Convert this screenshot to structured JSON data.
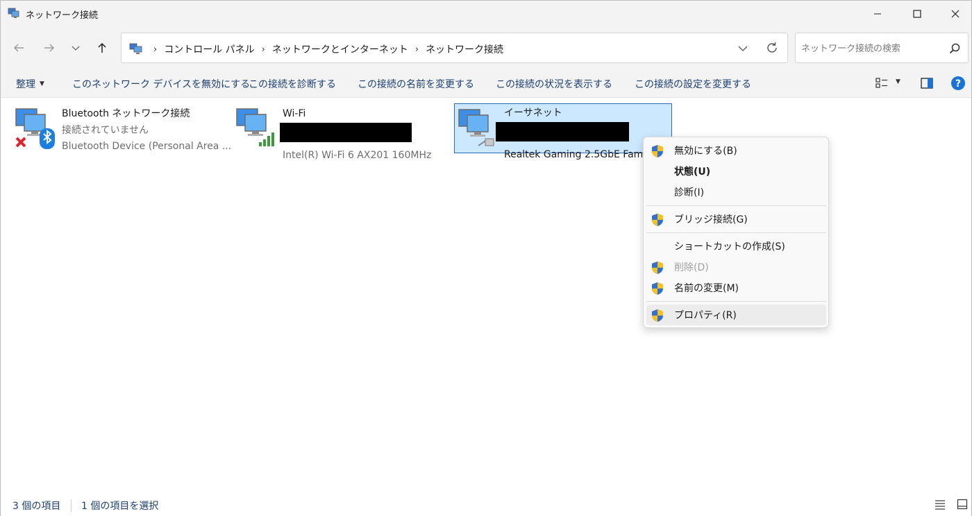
{
  "window": {
    "title": "ネットワーク接続"
  },
  "address": {
    "crumbs": [
      "コントロール パネル",
      "ネットワークとインターネット",
      "ネットワーク接続"
    ]
  },
  "search": {
    "placeholder": "ネットワーク接続の検索"
  },
  "commands": {
    "organize": "整理",
    "disable": "このネットワーク デバイスを無効にする",
    "diagnose": "この接続を診断する",
    "rename": "この接続の名前を変更する",
    "status": "この接続の状況を表示する",
    "settings": "この接続の設定を変更する"
  },
  "connections": [
    {
      "name": "Bluetooth ネットワーク接続",
      "status": "接続されていません",
      "device": "Bluetooth Device (Personal Area ...",
      "icon": "bluetooth-network-icon"
    },
    {
      "name": "Wi-Fi",
      "status": "",
      "device": "Intel(R) Wi-Fi 6 AX201 160MHz",
      "icon": "wifi-network-icon"
    },
    {
      "name": "イーサネット",
      "status": "",
      "device": "Realtek Gaming 2.5GbE Family",
      "icon": "ethernet-network-icon"
    }
  ],
  "context_menu": {
    "items": [
      {
        "label": "無効にする(B)",
        "shield": true
      },
      {
        "label": "状態(U)",
        "bold": true
      },
      {
        "label": "診断(I)"
      },
      {
        "label": "ブリッジ接続(G)",
        "shield": true
      },
      {
        "label": "ショートカットの作成(S)"
      },
      {
        "label": "削除(D)",
        "shield": true,
        "disabled": true
      },
      {
        "label": "名前の変更(M)",
        "shield": true
      },
      {
        "label": "プロパティ(R)",
        "shield": true
      }
    ]
  },
  "statusbar": {
    "count": "3 個の項目",
    "selected": "1 個の項目を選択"
  },
  "colors": {
    "selection_bg": "#cce8ff",
    "selection_border": "#2b6cb8",
    "link_text": "#1b3f73"
  }
}
